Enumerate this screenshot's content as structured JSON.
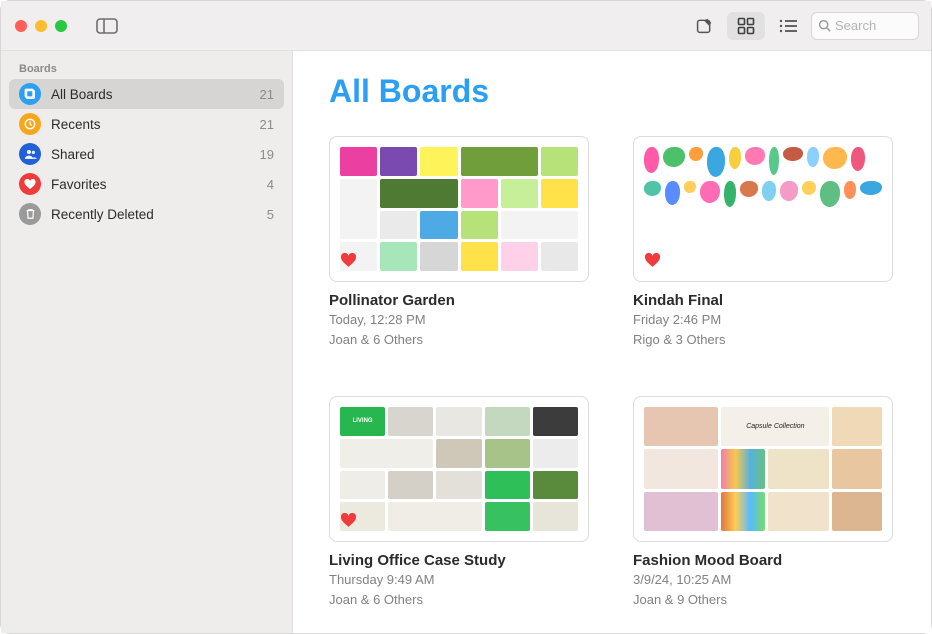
{
  "toolbar": {
    "search_placeholder": "Search"
  },
  "sidebar": {
    "header": "Boards",
    "items": [
      {
        "label": "All Boards",
        "count": "21",
        "icon": "all",
        "color": "#2b9ff4",
        "selected": true
      },
      {
        "label": "Recents",
        "count": "21",
        "icon": "clock",
        "color": "#f7a71d",
        "selected": false
      },
      {
        "label": "Shared",
        "count": "19",
        "icon": "people",
        "color": "#2260d9",
        "selected": false
      },
      {
        "label": "Favorites",
        "count": "4",
        "icon": "heart",
        "color": "#ef3b3b",
        "selected": false
      },
      {
        "label": "Recently Deleted",
        "count": "5",
        "icon": "trash",
        "color": "#9a9a9a",
        "selected": false
      }
    ]
  },
  "main": {
    "title": "All Boards",
    "boards": [
      {
        "title": "Pollinator Garden",
        "timestamp": "Today, 12:28 PM",
        "sharing": "Joan & 6 Others",
        "favorited": true
      },
      {
        "title": "Kindah Final",
        "timestamp": "Friday 2:46 PM",
        "sharing": "Rigo & 3 Others",
        "favorited": true
      },
      {
        "title": "Living Office Case Study",
        "timestamp": "Thursday 9:49 AM",
        "sharing": "Joan & 6 Others",
        "favorited": true
      },
      {
        "title": "Fashion Mood Board",
        "timestamp": "3/9/24, 10:25 AM",
        "sharing": "Joan & 9 Others",
        "favorited": false
      }
    ]
  }
}
